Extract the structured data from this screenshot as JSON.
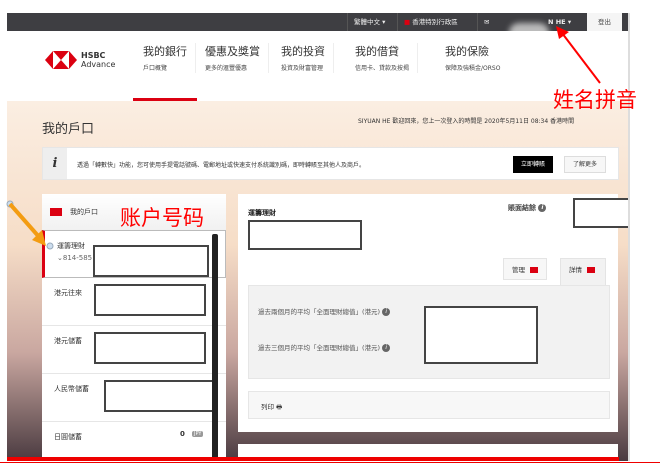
{
  "topbar": {
    "language": "繁體中文",
    "region": "香港特別行政區",
    "user": "N HE",
    "logout": "登出"
  },
  "brand": {
    "line1": "HSBC",
    "line2": "Advance"
  },
  "nav": [
    {
      "title": "我的銀行",
      "sub": "戶口概覽"
    },
    {
      "title": "優惠及獎賞",
      "sub": "更多的滙豐優惠"
    },
    {
      "title": "我的投資",
      "sub": "投資及財富管理"
    },
    {
      "title": "我的借貸",
      "sub": "信用卡、貸款及按揭"
    },
    {
      "title": "我的保險",
      "sub": "保障及強積金/ORSO"
    }
  ],
  "page": {
    "title": "我的戶口",
    "welcome": "SIYUAN HE 歡迎回來，您上一次登入的時間是 2020年5月11日 08:34 香港時間"
  },
  "banner": {
    "message": "透過「轉數快」功能，您可使用手提電話號碼、電郵地址或快速支付系統識別碼，即時轉賬至其他人及商戶。",
    "primary": "立即轉賬",
    "secondary": "了解更多"
  },
  "accounts": {
    "header": "我的戶口",
    "items": [
      {
        "name": "運籌理財",
        "number": "814-585"
      },
      {
        "name": "港元往來"
      },
      {
        "name": "港元儲蓄"
      },
      {
        "name": "人民幣儲蓄"
      },
      {
        "name": "日圓儲蓄",
        "balance": "0",
        "currency": "JPY"
      }
    ]
  },
  "detail": {
    "title": "運籌理財",
    "balance_label": "賬面結餘",
    "tab_manage": "管理",
    "tab_details": "詳情",
    "avg2": "過去兩個月的平均「全面理財總值」(港元)",
    "avg3": "過去三個月的平均「全面理財總值」(港元)",
    "print": "列印"
  },
  "annotations": {
    "name": "姓名拼音",
    "account": "账户号码"
  },
  "colors": {
    "brand_red": "#db0011",
    "annotation_red": "#ff0000",
    "arrow_orange": "#f39c12"
  }
}
